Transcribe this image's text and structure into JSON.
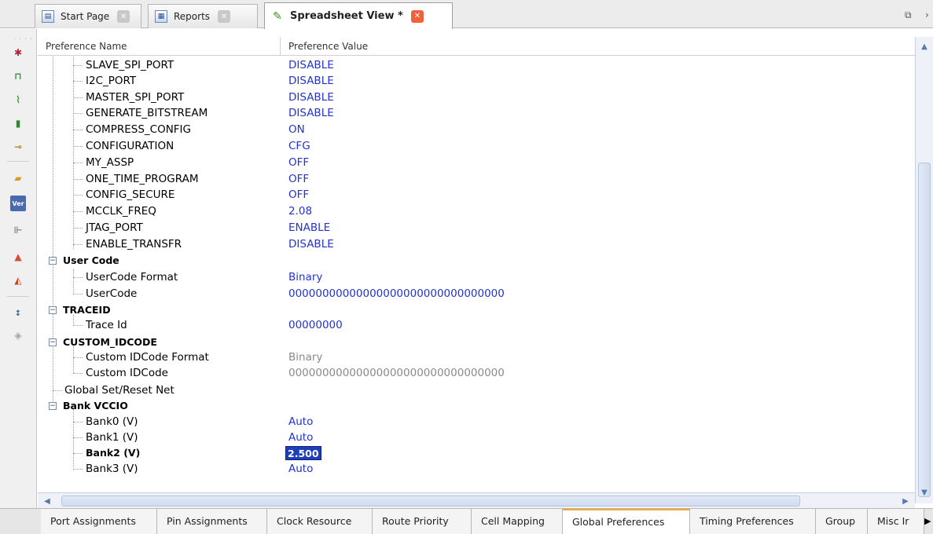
{
  "top_tabs": [
    {
      "label": "Start Page",
      "icon": "start-page-icon"
    },
    {
      "label": "Reports",
      "icon": "reports-icon"
    },
    {
      "label": "Spreadsheet View *",
      "icon": "spreadsheet-icon"
    }
  ],
  "grid": {
    "headers": [
      "Preference Name",
      "Preference Value"
    ],
    "rows": [
      {
        "name": "SLAVE_SPI_PORT",
        "value": "DISABLE"
      },
      {
        "name": "I2C_PORT",
        "value": "DISABLE"
      },
      {
        "name": "MASTER_SPI_PORT",
        "value": "DISABLE"
      },
      {
        "name": "GENERATE_BITSTREAM",
        "value": "DISABLE"
      },
      {
        "name": "COMPRESS_CONFIG",
        "value": "ON"
      },
      {
        "name": "CONFIGURATION",
        "value": "CFG"
      },
      {
        "name": "MY_ASSP",
        "value": "OFF"
      },
      {
        "name": "ONE_TIME_PROGRAM",
        "value": "OFF"
      },
      {
        "name": "CONFIG_SECURE",
        "value": "OFF"
      },
      {
        "name": "MCCLK_FREQ",
        "value": "2.08"
      },
      {
        "name": "JTAG_PORT",
        "value": "ENABLE"
      },
      {
        "name": "ENABLE_TRANSFR",
        "value": "DISABLE"
      },
      {
        "name": "User Code",
        "value": ""
      },
      {
        "name": "UserCode Format",
        "value": "Binary"
      },
      {
        "name": "UserCode",
        "value": "00000000000000000000000000000000"
      },
      {
        "name": "TRACEID",
        "value": ""
      },
      {
        "name": "Trace Id",
        "value": "00000000"
      },
      {
        "name": "CUSTOM_IDCODE",
        "value": ""
      },
      {
        "name": "Custom IDCode Format",
        "value": "Binary"
      },
      {
        "name": "Custom IDCode",
        "value": "00000000000000000000000000000000"
      },
      {
        "name": "Global Set/Reset Net",
        "value": ""
      },
      {
        "name": "Bank VCCIO",
        "value": ""
      },
      {
        "name": "Bank0 (V)",
        "value": "Auto"
      },
      {
        "name": "Bank1 (V)",
        "value": "Auto"
      },
      {
        "name": "Bank2 (V)",
        "value": "2.500"
      },
      {
        "name": "Bank3 (V)",
        "value": "Auto"
      }
    ]
  },
  "bottom_tabs": [
    "Port Assignments",
    "Pin Assignments",
    "Clock Resource",
    "Route Priority",
    "Cell Mapping",
    "Global Preferences",
    "Timing Preferences",
    "Group",
    "Misc Ir"
  ],
  "active_bottom_tab": "Global Preferences",
  "colors": {
    "value_text": "#2233cc",
    "disabled_text": "#8a8a8a",
    "selection": "#1f3fb8",
    "active_close": "#f0603c"
  }
}
